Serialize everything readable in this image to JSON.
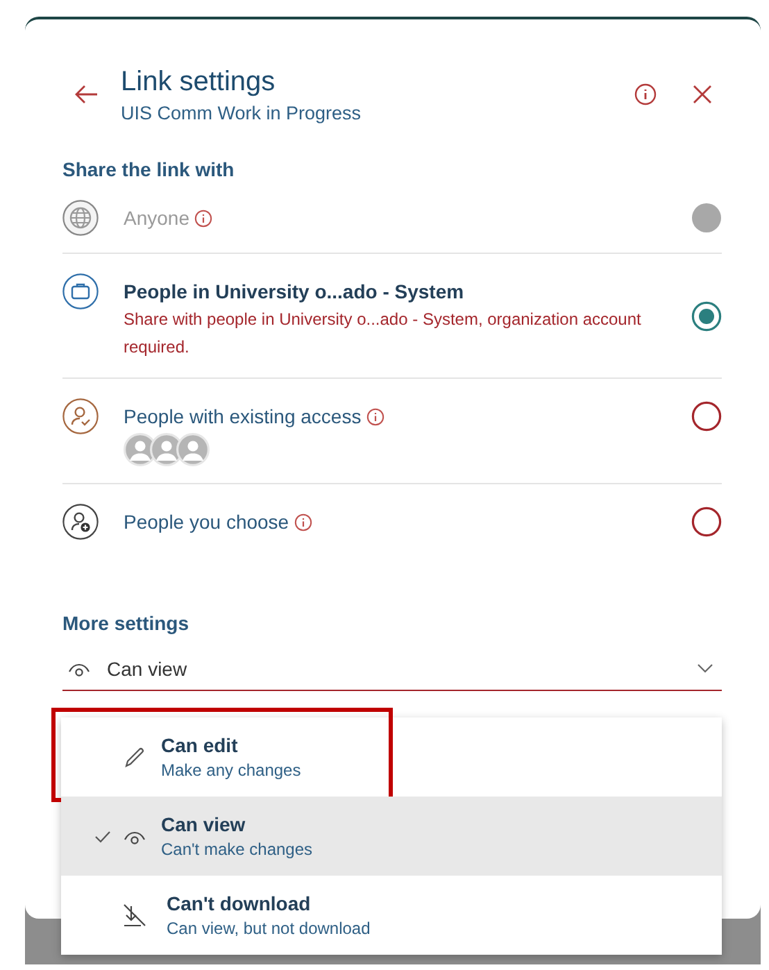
{
  "dialog": {
    "title": "Link settings",
    "subtitle": "UIS Comm Work in Progress"
  },
  "share_section": {
    "heading": "Share the link with",
    "options": [
      {
        "kind": "globe",
        "label": "Anyone",
        "info": true,
        "disabled": true,
        "selected": false
      },
      {
        "kind": "organization",
        "label": "People in University o...ado - System",
        "description": "Share with people in University o...ado - System, organization account required.",
        "info": false,
        "disabled": false,
        "selected": true
      },
      {
        "kind": "existing",
        "label": "People with existing access",
        "info": true,
        "disabled": false,
        "selected": false,
        "avatars": [
          {
            "kind": "generic"
          },
          {
            "kind": "generic"
          },
          {
            "kind": "generic"
          }
        ]
      },
      {
        "kind": "choose",
        "label": "People you choose",
        "info": true,
        "disabled": false,
        "selected": false
      }
    ]
  },
  "more_settings": {
    "heading": "More settings",
    "dropdown": {
      "value": "Can view",
      "expanded": true
    },
    "menu": [
      {
        "kind": "edit",
        "label": "Can edit",
        "description": "Make any changes",
        "selected": false,
        "highlighted": true
      },
      {
        "kind": "view",
        "label": "Can view",
        "description": "Can't make changes",
        "selected": true,
        "highlighted": false
      },
      {
        "kind": "nodownload",
        "label": "Can't download",
        "description": "Can view, but not download",
        "selected": false,
        "highlighted": false
      }
    ]
  }
}
